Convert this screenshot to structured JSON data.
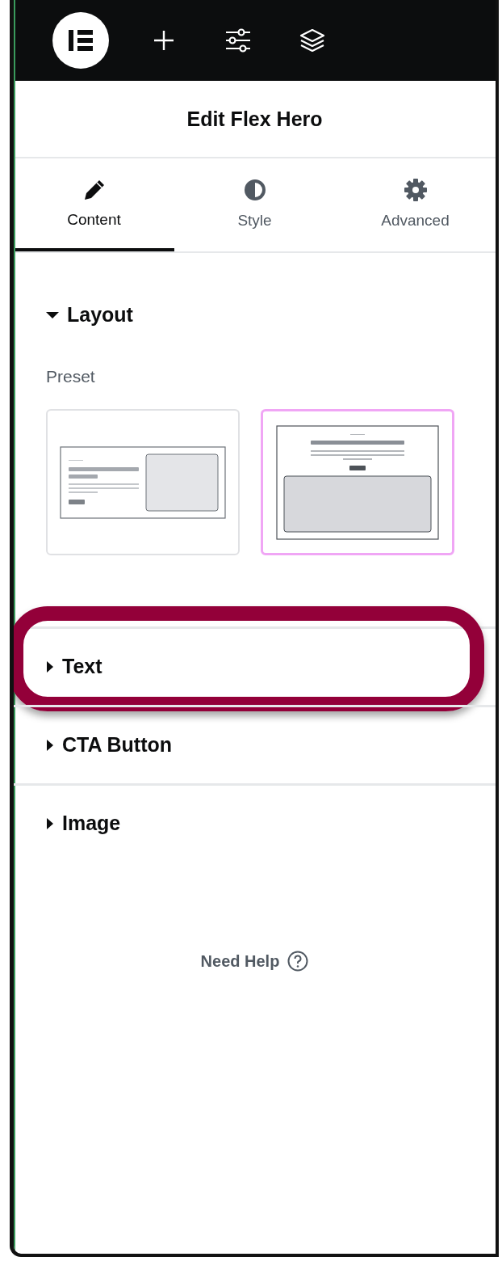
{
  "toolbar": {
    "items": [
      {
        "kind": "logo"
      },
      {
        "kind": "add"
      },
      {
        "kind": "settings"
      },
      {
        "kind": "layers"
      }
    ]
  },
  "panel": {
    "title": "Edit Flex Hero"
  },
  "tabs": [
    {
      "label": "Content",
      "kind": "pencil",
      "selected": true
    },
    {
      "label": "Style",
      "kind": "contrast",
      "selected": false
    },
    {
      "label": "Advanced",
      "kind": "gear",
      "selected": false
    }
  ],
  "sections": [
    {
      "title": "Layout",
      "expanded": true,
      "highlighted": false,
      "preset": {
        "label": "Preset",
        "options": [
          {
            "kind": "side",
            "selected": false
          },
          {
            "kind": "stacked",
            "selected": true
          }
        ]
      }
    },
    {
      "title": "Text",
      "expanded": false,
      "highlighted": true
    },
    {
      "title": "CTA Button",
      "expanded": false,
      "highlighted": false
    },
    {
      "title": "Image",
      "expanded": false,
      "highlighted": false
    }
  ],
  "help": {
    "label": "Need Help"
  }
}
